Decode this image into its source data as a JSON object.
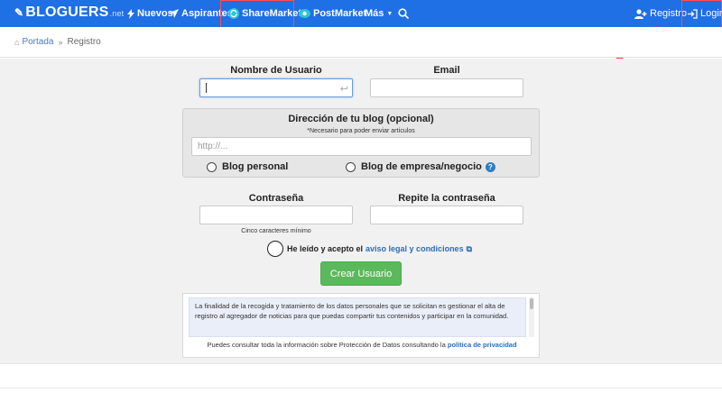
{
  "nav": {
    "brand": "BLOGUERS",
    "brand_tld": ".net",
    "items": [
      {
        "label": "Nuevos",
        "icon": "bolt-icon"
      },
      {
        "label": "Aspirantes",
        "icon": "paper-plane-icon"
      },
      {
        "label": "ShareMarket",
        "icon": "refresh-icon"
      },
      {
        "label": "PostMarket",
        "icon": "eye-icon"
      },
      {
        "label": "Más",
        "icon": "caret-down-icon"
      }
    ],
    "registro": "Registro",
    "login": "Login"
  },
  "breadcrumb": {
    "home": "Portada",
    "current": "Registro"
  },
  "form": {
    "username_label": "Nombre de Usuario",
    "email_label": "Email",
    "blog_title": "Dirección de tu blog (opcional)",
    "blog_note": "*Necesario para poder enviar artículos",
    "blog_placeholder": "http://...",
    "radio_personal": "Blog personal",
    "radio_business": "Blog de empresa/negocio",
    "password_label": "Contraseña",
    "password_repeat_label": "Repite la contraseña",
    "password_hint": "Cinco caracteres mínimo",
    "accept_text": "He leído y acepto el",
    "accept_link": "aviso legal y condiciones",
    "create_button": "Crear Usuario"
  },
  "privacy": {
    "text": "La finalidad de la recogida y tratamiento de los datos personales que se solicitan es gestionar el alta de registro al agregador de noticias para que puedas compartir tus contenidos y participar en la comunidad.",
    "footer_text": "Puedes consultar toda la información sobre Protección de Datos consultando la",
    "footer_link": "política de privacidad"
  },
  "colors": {
    "navbar": "#1f6fe5",
    "button_green": "#5cb85c",
    "link_blue": "#2a6fb8",
    "annotation_red": "#e8473a"
  }
}
